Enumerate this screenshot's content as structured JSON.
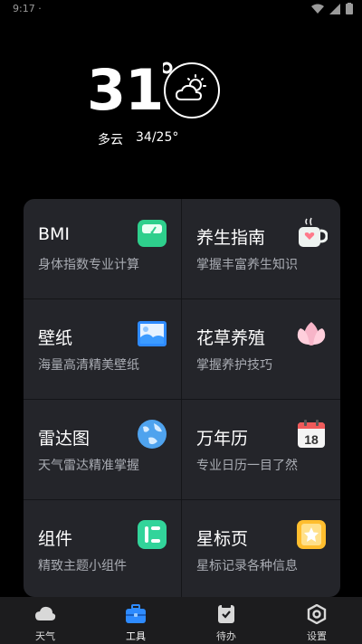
{
  "status_bar": {
    "left_text": "9:17 ·"
  },
  "weather": {
    "temperature": "31",
    "condition": "多云",
    "range": "34/25°",
    "icon": "partly-cloudy-icon"
  },
  "tools": [
    {
      "title": "BMI",
      "subtitle": "身体指数专业计算",
      "icon": "scale-icon"
    },
    {
      "title": "养生指南",
      "subtitle": "掌握丰富养生知识",
      "icon": "tea-cup-icon"
    },
    {
      "title": "壁纸",
      "subtitle": "海量高清精美壁纸",
      "icon": "picture-icon"
    },
    {
      "title": "花草养殖",
      "subtitle": "掌握养护技巧",
      "icon": "lotus-icon"
    },
    {
      "title": "雷达图",
      "subtitle": "天气雷达精准掌握",
      "icon": "globe-icon"
    },
    {
      "title": "万年历",
      "subtitle": "专业日历一目了然",
      "icon": "calendar-icon",
      "calendar_day": "18"
    },
    {
      "title": "组件",
      "subtitle": "精致主题小组件",
      "icon": "widget-icon"
    },
    {
      "title": "星标页",
      "subtitle": "星标记录各种信息",
      "icon": "star-page-icon"
    }
  ],
  "tabbar": {
    "items": [
      {
        "label": "天气",
        "icon": "cloud-icon",
        "active": false
      },
      {
        "label": "工具",
        "icon": "toolbox-icon",
        "active": true
      },
      {
        "label": "待办",
        "icon": "todo-icon",
        "active": false
      },
      {
        "label": "设置",
        "icon": "settings-icon",
        "active": false
      }
    ]
  },
  "colors": {
    "accent": "#2e8bff",
    "panel": "#24252a",
    "background": "#000000"
  }
}
